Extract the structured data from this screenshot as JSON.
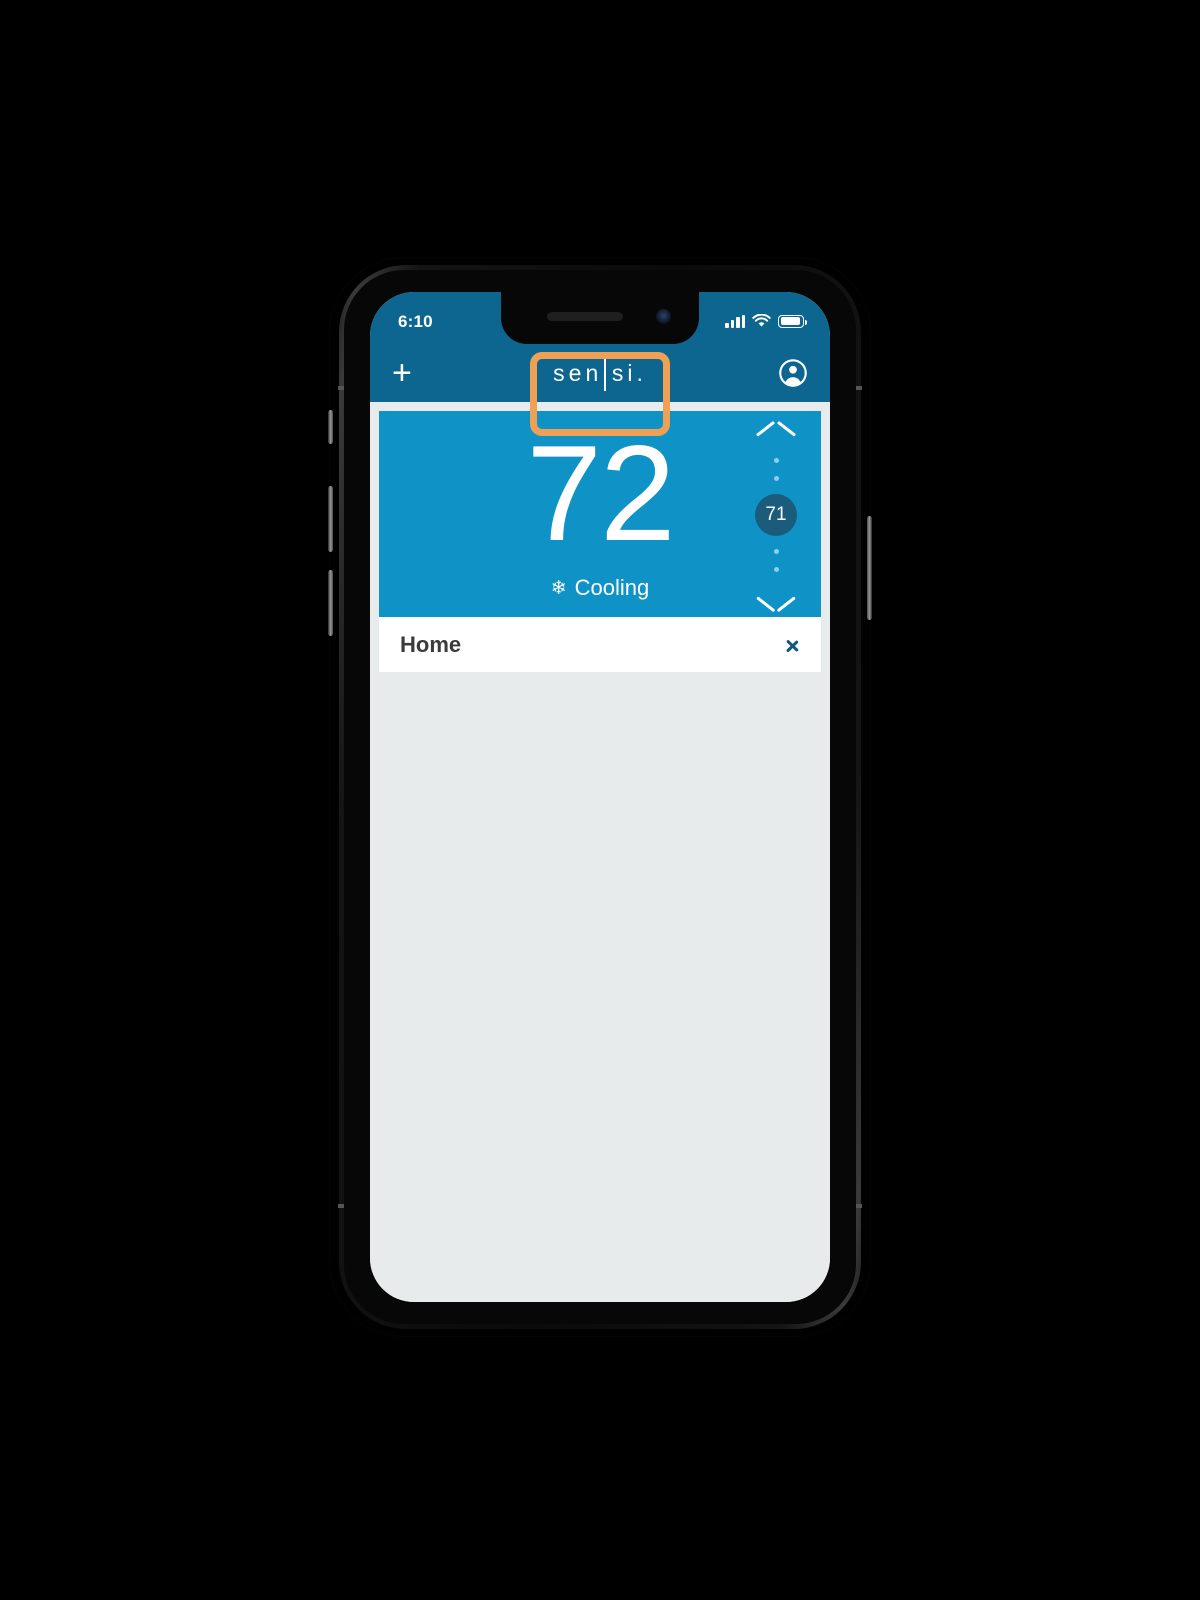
{
  "status_bar": {
    "time": "6:10",
    "signal_icon": "cellular-signal-icon",
    "wifi_icon": "wifi-icon",
    "battery_icon": "battery-icon"
  },
  "header": {
    "add_label": "+",
    "brand_left": "sen",
    "brand_right": "si.",
    "account_icon": "account-circle-icon",
    "background_color": "#0c6690"
  },
  "highlight": {
    "target": "sensi-logo",
    "color": "#f0a055"
  },
  "thermostat": {
    "current_temperature": "72",
    "mode_icon": "❄",
    "mode_label": "Cooling",
    "setpoint": "71",
    "increase_icon": "chevron-up-icon",
    "decrease_icon": "chevron-down-icon",
    "card_color": "#0f93c7",
    "badge_color": "#1b5c7c"
  },
  "location": {
    "name": "Home",
    "chevron_icon": "chevron-right-icon"
  }
}
